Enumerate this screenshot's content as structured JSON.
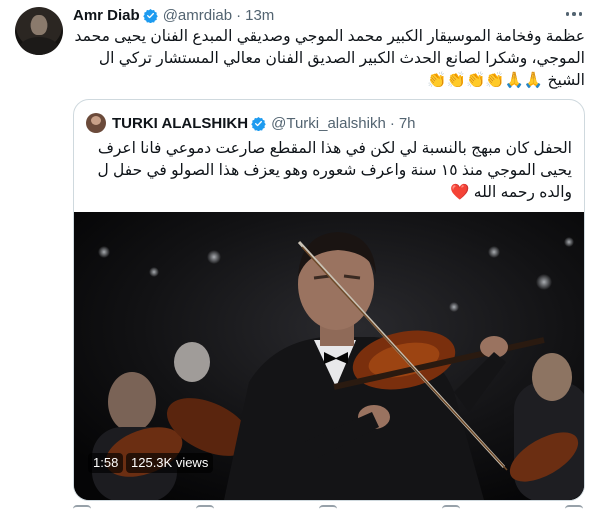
{
  "tweet": {
    "author_name": "Amr Diab",
    "handle": "@amrdiab",
    "separator": "·",
    "time": "13m",
    "text": "عظمة وفخامة الموسيقار الكبير محمد الموجي وصديقي المبدع الفنان يحيى محمد الموجي، وشكرا لصانع الحدث الكبير الصديق الفنان معالي المستشار تركي ال الشيخ 🙏🙏👏👏👏👏"
  },
  "quoted": {
    "author_name": "TURKI ALALSHIKH",
    "handle": "@Turki_alalshikh",
    "separator": "·",
    "time": "7h",
    "text": "الحفل كان مبهج بالنسبة لي لكن في هذا المقطع صارعت دموعي فانا اعرف يحيى الموجي منذ ١٥ سنة واعرف شعوره وهو يعزف هذا الصولو في حفل ل والده رحمه الله",
    "heart": "❤️",
    "video": {
      "duration": "1:58",
      "views": "125.3K views"
    }
  },
  "colors": {
    "verified_blue": "#1d9bf0",
    "text_primary": "#0f1419",
    "text_secondary": "#536471",
    "border": "#cfd9de"
  }
}
